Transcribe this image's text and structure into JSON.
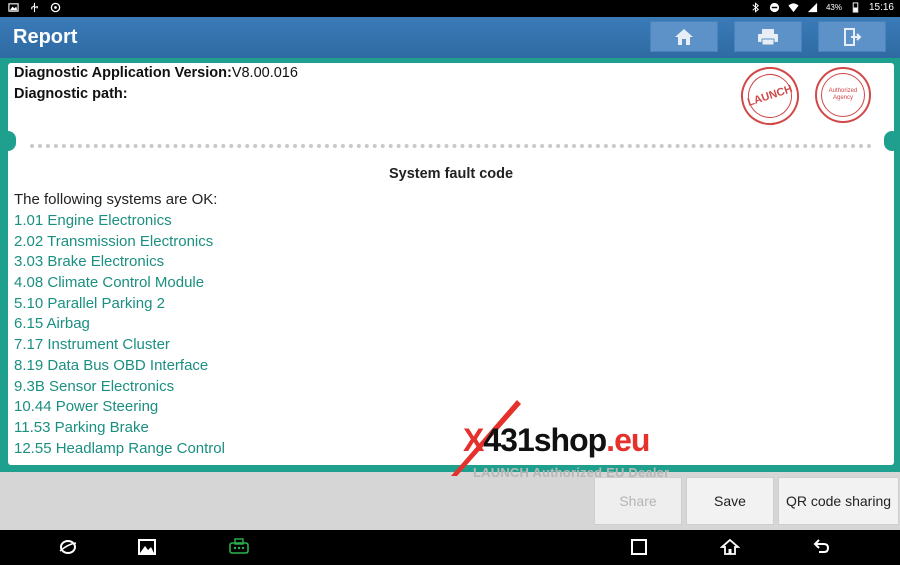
{
  "statusbar": {
    "battery": "43%",
    "time": "15:16",
    "icons": [
      "image-icon",
      "usb-icon",
      "settings-icon",
      "bluetooth-icon",
      "dnd-icon",
      "wifi-icon",
      "signal-icon",
      "battery-icon"
    ]
  },
  "header": {
    "title": "Report",
    "buttons": [
      "home-icon",
      "print-icon",
      "exit-icon"
    ]
  },
  "report": {
    "version_label": "Diagnostic Application Version:",
    "version_value": "V8.00.016",
    "path_label": "Diagnostic path:",
    "stamp_launch": "LAUNCH",
    "stamp_authorized": "Authorized Agency",
    "section_title": "System fault code",
    "ok_label": "The following systems are OK:",
    "systems": [
      "1.01 Engine Electronics",
      "2.02 Transmission Electronics",
      "3.03 Brake Electronics",
      "4.08 Climate Control Module",
      "5.10 Parallel Parking 2",
      "6.15 Airbag",
      "7.17 Instrument Cluster",
      "8.19 Data Bus OBD Interface",
      "9.3B Sensor Electronics",
      "10.44 Power Steering",
      "11.53 Parking Brake",
      "12.55 Headlamp Range Control"
    ]
  },
  "watermark": {
    "brand_x": "X",
    "brand_431": "431",
    "brand_shop": "shop",
    "brand_eu": ".eu",
    "tagline": "LAUNCH Authorized EU Dealer"
  },
  "actions": {
    "share": "Share",
    "save": "Save",
    "qr": "QR code sharing"
  },
  "navbar": {
    "icons": [
      "browser-icon",
      "gallery-icon",
      "vci-icon",
      "recents-icon",
      "home-nav-icon",
      "back-icon"
    ]
  },
  "colors": {
    "titlebar": "#3a7bb8",
    "frame": "#1fa08f",
    "list_text": "#1b8f80",
    "brand_red": "#e4312c"
  }
}
